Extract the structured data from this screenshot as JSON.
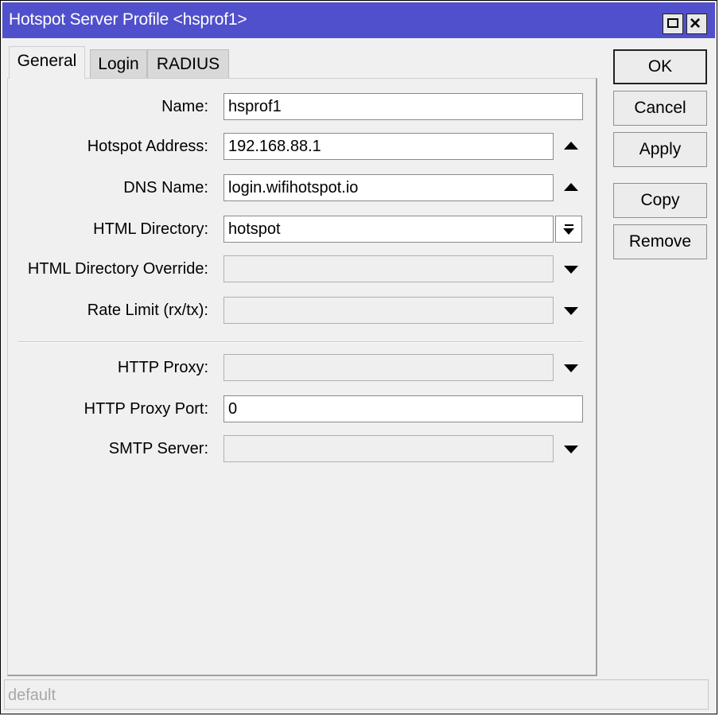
{
  "window": {
    "title": "Hotspot Server Profile <hsprof1>"
  },
  "tabs": [
    {
      "label": "General",
      "active": true
    },
    {
      "label": "Login",
      "active": false
    },
    {
      "label": "RADIUS",
      "active": false
    }
  ],
  "form": {
    "name": {
      "label": "Name:",
      "value": "hsprof1"
    },
    "hotspot_address": {
      "label": "Hotspot Address:",
      "value": "192.168.88.1"
    },
    "dns_name": {
      "label": "DNS Name:",
      "value": "login.wifihotspot.io"
    },
    "html_directory": {
      "label": "HTML Directory:",
      "value": "hotspot"
    },
    "html_directory_override": {
      "label": "HTML Directory Override:",
      "value": ""
    },
    "rate_limit": {
      "label": "Rate Limit (rx/tx):",
      "value": ""
    },
    "http_proxy": {
      "label": "HTTP Proxy:",
      "value": ""
    },
    "http_proxy_port": {
      "label": "HTTP Proxy Port:",
      "value": "0"
    },
    "smtp_server": {
      "label": "SMTP Server:",
      "value": ""
    }
  },
  "buttons": {
    "ok": "OK",
    "cancel": "Cancel",
    "apply": "Apply",
    "copy": "Copy",
    "remove": "Remove"
  },
  "status": {
    "text": "default"
  },
  "icons": {
    "maximize": "maximize-icon",
    "close": "close-icon",
    "expand_up": "triangle-up-icon",
    "expand_down": "triangle-down-icon",
    "dropdown": "dropdown-arrow-icon"
  },
  "colors": {
    "titlebar": "#5050cc",
    "window_bg": "#f0f0f0"
  }
}
